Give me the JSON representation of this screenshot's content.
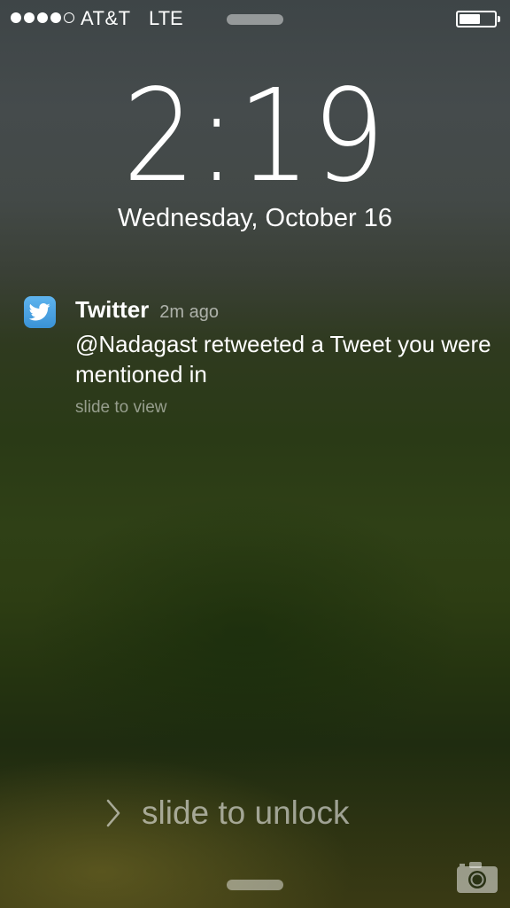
{
  "status_bar": {
    "signal_bars_filled": 4,
    "signal_bars_total": 5,
    "carrier": "AT&T",
    "network": "LTE",
    "battery_level": 0.6
  },
  "lock_screen": {
    "time": "2:19",
    "date": "Wednesday, October 16",
    "unlock_label": "slide to unlock"
  },
  "notification": {
    "app_name": "Twitter",
    "icon": "twitter-bird-icon",
    "time_ago": "2m ago",
    "message": "@Nadagast retweeted a Tweet you were mentioned in",
    "hint": "slide to view"
  },
  "colors": {
    "twitter_blue": "#4aa3e3",
    "text": "#ffffff"
  }
}
